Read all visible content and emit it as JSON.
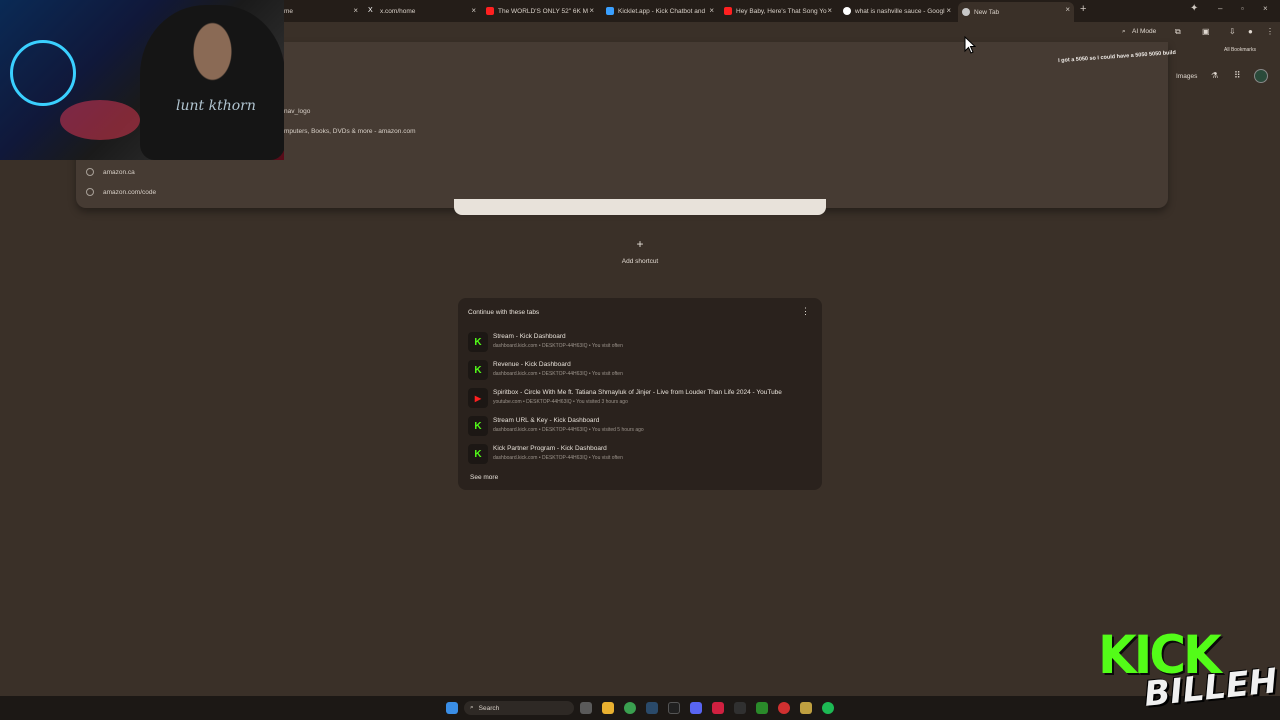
{
  "tabs": [
    {
      "label": "me",
      "color": "#c8c8c8"
    },
    {
      "label": "x.com/home",
      "color": "#ffffff"
    },
    {
      "label": "The WORLD'S ONLY 52\" 6K M",
      "color": "#ff2020"
    },
    {
      "label": "Kicklet.app - Kick Chatbot and",
      "color": "#3aa0ff"
    },
    {
      "label": "Hey Baby, Here's That Song Yo",
      "color": "#ff2020"
    },
    {
      "label": "what is nashville sauce - Googl",
      "color": "#ffffff"
    },
    {
      "label": "New Tab",
      "color": "#c8c8c8"
    }
  ],
  "new_tab_symbol": "+",
  "close_symbol": "×",
  "window_controls": {
    "min": "–",
    "max": "▫",
    "close": "×"
  },
  "toolbar": {
    "ai_mode": "AI Mode",
    "all_bookmarks": "All Bookmarks",
    "images": "Images",
    "overlay_text": "I got a 5050 so I could have a 5050 5050 build"
  },
  "omnibox_suggestions": [
    {
      "text": "nav_logo"
    },
    {
      "text": "mputers, Books, DVDs & more - amazon.com"
    },
    {
      "text": "amazon.ca"
    },
    {
      "text": "amazon.com/code"
    }
  ],
  "webcam": {
    "shirt_text": "lunt kthorn"
  },
  "shortcut": {
    "plus": "+",
    "label": "Add shortcut"
  },
  "continue_card": {
    "title": "Continue with these tabs",
    "menu_symbol": "⋮",
    "items": [
      {
        "icon": "K",
        "icon_color": "#53fc18",
        "title": "Stream - Kick Dashboard",
        "subtitle": "dashboard.kick.com • DESKTOP-44H63IQ • You visit often"
      },
      {
        "icon": "▶",
        "icon_color": "#ff2020",
        "title": "Revenue - Kick Dashboard",
        "subtitle": "dashboard.kick.com • DESKTOP-44H63IQ • You visit often"
      },
      {
        "icon": "▶",
        "icon_color": "#ff2020",
        "title": "Spiritbox - Circle With Me ft. Tatiana Shmayluk of Jinjer - Live from Louder Than Life 2024 - YouTube",
        "subtitle": "youtube.com • DESKTOP-44H63IQ • You visited 3 hours ago"
      },
      {
        "icon": "K",
        "icon_color": "#53fc18",
        "title": "Stream URL & Key - Kick Dashboard",
        "subtitle": "dashboard.kick.com • DESKTOP-44H63IQ • You visited 5 hours ago"
      },
      {
        "icon": "K",
        "icon_color": "#53fc18",
        "title": "Kick Partner Program - Kick Dashboard",
        "subtitle": "dashboard.kick.com • DESKTOP-44H63IQ • You visit often"
      }
    ],
    "see_more": "See more"
  },
  "taskbar": {
    "search_label": "Search"
  },
  "kick_logo": {
    "top": "KICK",
    "bottom": "BILLEH"
  }
}
